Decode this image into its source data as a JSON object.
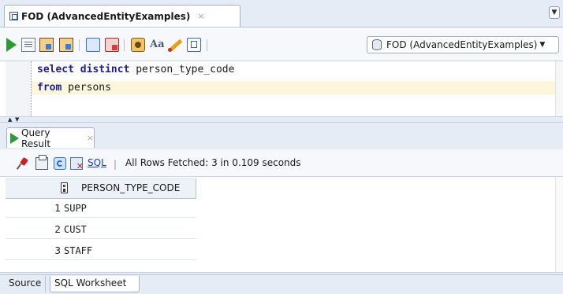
{
  "editor_tab": {
    "title": "FOD (AdvancedEntityExamples)",
    "close": "×"
  },
  "tab_menu": {
    "glyph": "▼"
  },
  "toolbar": {
    "connection": "FOD (AdvancedEntityExamples)",
    "connection_arrow": "▼",
    "aa_glyph": "Aa"
  },
  "editor": {
    "lines": [
      {
        "keyword": "select distinct",
        "rest": " person_type_code"
      },
      {
        "keyword": "from",
        "rest": " persons"
      }
    ]
  },
  "splitter": {
    "up": "▲",
    "down": "▼"
  },
  "result_tab": {
    "title": "Query Result",
    "close": "×"
  },
  "result_toolbar": {
    "sql_link": "SQL",
    "separator": "|",
    "status": "All Rows Fetched: 3 in 0.109 seconds"
  },
  "grid": {
    "column": "PERSON_TYPE_CODE",
    "rows": [
      {
        "num": "1",
        "value": "SUPP"
      },
      {
        "num": "2",
        "value": "CUST"
      },
      {
        "num": "3",
        "value": "STAFF"
      }
    ]
  },
  "bottom_tabs": {
    "source": "Source",
    "worksheet": "SQL Worksheet"
  },
  "colors": {
    "run_green": "#2c9a34",
    "keyword": "#1b1e8f",
    "link": "#1a3cc4",
    "current_line": "#fbf6dc"
  }
}
